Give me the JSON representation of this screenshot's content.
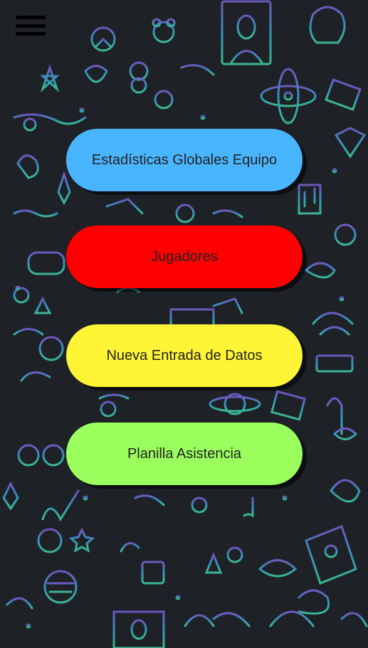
{
  "header": {
    "menu_icon": "hamburger-menu-icon"
  },
  "buttons": [
    {
      "label": "Estadísticas Globales Equipo",
      "color": "#4ab5ff"
    },
    {
      "label": "Jugadores",
      "color": "#ff0000"
    },
    {
      "label": "Nueva Entrada de Datos",
      "color": "#fff536"
    },
    {
      "label": "Planilla Asistencia",
      "color": "#9bff5e"
    }
  ],
  "background": {
    "base": "#1e2126",
    "doodle_colors": [
      "#3bc4d8",
      "#2db8a0",
      "#4a7fd8",
      "#7a62d8",
      "#b060c8",
      "#3fd2a4"
    ]
  }
}
